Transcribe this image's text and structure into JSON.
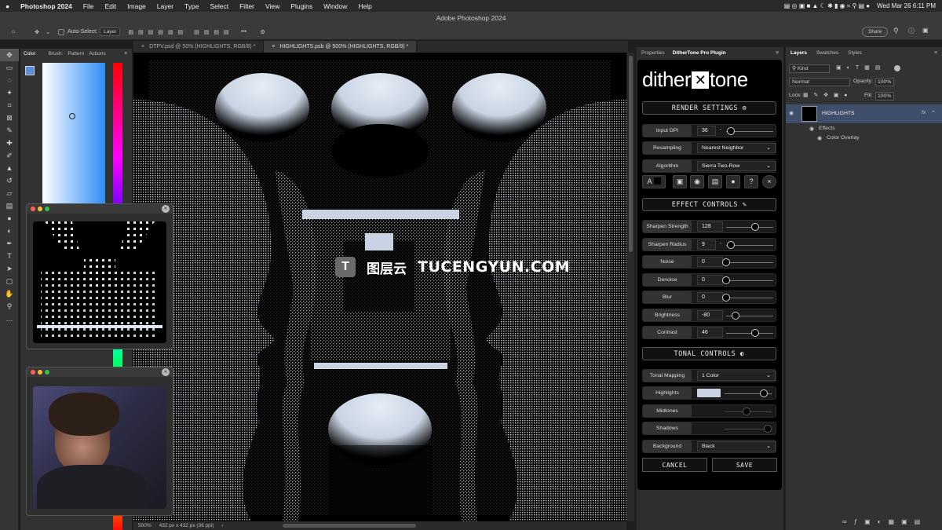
{
  "menubar": {
    "apple": "",
    "app": "Photoshop 2024",
    "items": [
      "File",
      "Edit",
      "Image",
      "Layer",
      "Type",
      "Select",
      "Filter",
      "View",
      "Plugins",
      "Window",
      "Help"
    ],
    "datetime": "Wed Mar 26  6:11 PM"
  },
  "titlebar": {
    "title": "Adobe Photoshop 2024"
  },
  "options": {
    "auto_select_label": "Auto-Select:",
    "auto_select_value": "Layer",
    "more": "•••",
    "share": "Share"
  },
  "tools": [
    "move",
    "marquee",
    "lasso",
    "magic-wand",
    "crop",
    "frame",
    "eyedropper",
    "spot-heal",
    "brush",
    "stamp",
    "history-brush",
    "eraser",
    "gradient",
    "blur",
    "dodge",
    "pen",
    "type",
    "path-select",
    "shape",
    "hand",
    "zoom",
    "more"
  ],
  "color_panel": {
    "tabs": [
      "Color",
      "Brush:",
      "Pattern",
      "Actions"
    ]
  },
  "doc_tabs": [
    {
      "label": "DTPV.psd @ 50% (HIGHLIGHTS, RGB/8) *",
      "active": false
    },
    {
      "label": "HIGHLIGHTS.psb @ 500% (HIGHLIGHTS, RGB/8) *",
      "active": true
    }
  ],
  "status": {
    "zoom": "500%",
    "size": "432 px x 432 px (36 ppi)",
    "arrow": "›"
  },
  "watermark": {
    "glyph": "T",
    "cn": "图层云",
    "en": "TUCENGYUN.COM"
  },
  "props_tabs": [
    "Properties",
    "DitherTone Pro Plugin"
  ],
  "plugin": {
    "logo_left": "dither",
    "logo_mark": "✕",
    "logo_right": "tone",
    "render_settings": "RENDER SETTINGS",
    "input_dpi_label": "Input DPI",
    "input_dpi": "36",
    "input_dpi_dash": "-",
    "input_dpi_level": 0.1,
    "resampling_label": "Resampling",
    "resampling": "Nearest Neighbor",
    "algorithm_label": "Algorithm",
    "algorithm": "Sierra Two-Row",
    "effect_controls": "EFFECT CONTROLS",
    "sharpen_strength_label": "Sharpen Strength",
    "sharpen_strength": "128",
    "sharpen_strength_level": 0.62,
    "sharpen_radius_label": "Sharpen Radius",
    "sharpen_radius": "9",
    "sharpen_radius_dash": "-",
    "sharpen_radius_level": 0.1,
    "noise_label": "Noise",
    "noise": "0",
    "noise_level": 0,
    "denoise_label": "Denoise",
    "denoise": "0",
    "denoise_level": 0,
    "blur_label": "Blur",
    "blur": "0",
    "blur_level": 0,
    "brightness_label": "Brightness",
    "brightness": "-80",
    "brightness_level": 0.2,
    "contrast_label": "Contrast",
    "contrast": "46",
    "contrast_level": 0.62,
    "tonal_controls": "TONAL CONTROLS",
    "tonal_mapping_label": "Tonal Mapping",
    "tonal_mapping": "1 Color",
    "highlights_label": "Highlights",
    "highlights_color": "#c9d3e3",
    "highlights_level": 1.0,
    "midtones_label": "Midtones",
    "midtones_level": 0.55,
    "shadows_label": "Shadows",
    "shadows_level": 1.0,
    "background_label": "Background",
    "background": "Black",
    "cancel": "CANCEL",
    "save": "SAVE"
  },
  "layers": {
    "tabs": [
      "Layers",
      "Swatches",
      "Styles"
    ],
    "kind": "Kind",
    "blend": "Normal",
    "opacity_label": "Opacity:",
    "opacity": "100%",
    "lock_label": "Lock:",
    "fill_label": "Fill:",
    "fill": "100%",
    "layer_name": "HIGHLIGHTS",
    "fx": "fx",
    "effects": "Effects",
    "color_overlay": "Color Overlay"
  },
  "colors": {
    "accent": "#4a90e2",
    "panel": "#323232",
    "highlight": "#c9d3e3"
  }
}
